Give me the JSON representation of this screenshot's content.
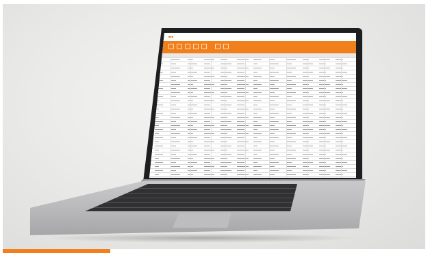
{
  "scene": {
    "subject": "laptop-with-spreadsheet-app",
    "accent_color": "#f07f1c",
    "background_color": "#ebebea"
  },
  "screen_app": {
    "ribbon_color": "#f07f1c",
    "logo_color": "#e8731a"
  }
}
